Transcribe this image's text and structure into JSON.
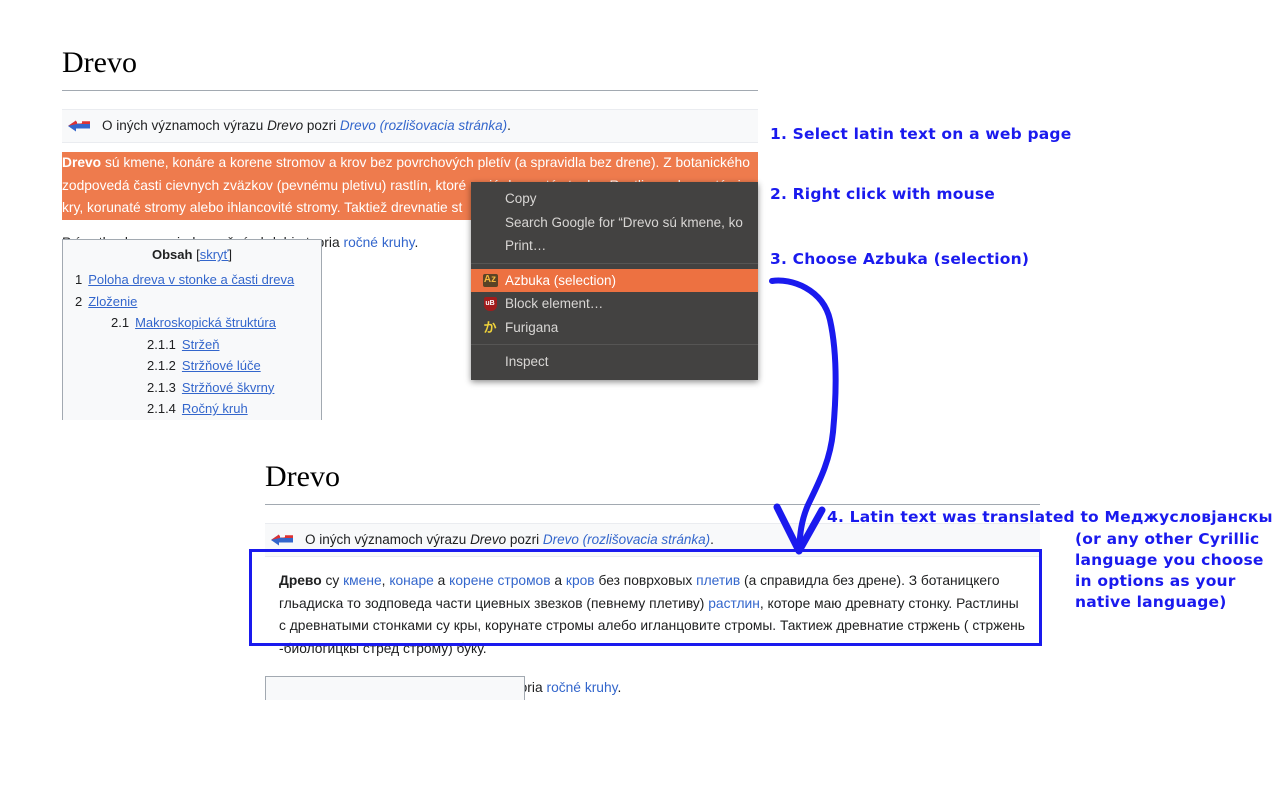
{
  "article_top": {
    "title": "Drevo",
    "hatnote": {
      "prefix": "O iných významoch výrazu ",
      "term": "Drevo",
      "middle": " pozri ",
      "link": "Drevo (rozlišovacia stránka)",
      "suffix": "."
    },
    "selection_paragraph": {
      "lead": "Drevo",
      "rest": " sú kmene, konáre a korene stromov a krov bez povrchových pletív (a spravidla bez drene). Z botanického zodpovedá časti cievnych zväzkov (pevnému pletivu) rastlín, ktoré majú drevnatú stonku. Rastliny s drevnatými s kry, korunaté stromy alebo ihlancovité stromy. Taktiež drevnatie st"
    },
    "second_paragraph": {
      "before": "Prírastky dreva za jedno ročné obdobie tvoria ",
      "link": "ročné kruhy",
      "after": "."
    },
    "toc": {
      "heading": "Obsah",
      "toggle_open": "[",
      "toggle_label": "skryť",
      "toggle_close": "]",
      "rows": [
        {
          "num": "1",
          "label": "Poloha dreva v stonke a časti dreva",
          "level": 1
        },
        {
          "num": "2",
          "label": "Zloženie",
          "level": 1
        },
        {
          "num": "2.1",
          "label": "Makroskopická štruktúra",
          "level": 2
        },
        {
          "num": "2.1.1",
          "label": "Stržeň",
          "level": 3
        },
        {
          "num": "2.1.2",
          "label": "Stržňové lúče",
          "level": 3
        },
        {
          "num": "2.1.3",
          "label": "Stržňové škvrny",
          "level": 3
        },
        {
          "num": "2.1.4",
          "label": "Ročný kruh",
          "level": 3
        }
      ]
    }
  },
  "context_menu": {
    "items": [
      {
        "label": "Copy",
        "icon": null,
        "highlight": false,
        "separator_after": false
      },
      {
        "label": "Search Google for “Drevo sú kmene, ko",
        "icon": null,
        "highlight": false,
        "separator_after": false
      },
      {
        "label": "Print…",
        "icon": null,
        "highlight": false,
        "separator_after": true
      },
      {
        "label": "Azbuka (selection)",
        "icon": "azbuka-icon",
        "highlight": true,
        "separator_after": false
      },
      {
        "label": "Block element…",
        "icon": "ublock-shield-icon",
        "highlight": false,
        "separator_after": false
      },
      {
        "label": "Furigana",
        "icon": "furigana-icon",
        "highlight": false,
        "separator_after": true
      },
      {
        "label": "Inspect",
        "icon": null,
        "highlight": false,
        "separator_after": false
      }
    ],
    "icon_glyphs": {
      "azbuka-icon": "Аz",
      "ublock-shield-icon": "uB",
      "furigana-icon": "か"
    },
    "colors": {
      "background": "#434241",
      "highlight": "#ed7141",
      "text": "#d8d6d4"
    }
  },
  "article_bottom": {
    "title": "Drevo",
    "hatnote": {
      "prefix": "O iných významoch výrazu ",
      "term": "Drevo",
      "middle": " pozri ",
      "link": "Drevo (rozlišovacia stránka)",
      "suffix": "."
    },
    "translated_paragraph": {
      "lead": "Древо",
      "segments": [
        {
          "text": " су ",
          "link": false
        },
        {
          "text": "кмене",
          "link": true
        },
        {
          "text": ", ",
          "link": false
        },
        {
          "text": "конаре",
          "link": true
        },
        {
          "text": " а ",
          "link": false
        },
        {
          "text": "корене стромов",
          "link": true
        },
        {
          "text": " а ",
          "link": false
        },
        {
          "text": "кров",
          "link": true
        },
        {
          "text": " без поврховых ",
          "link": false
        },
        {
          "text": "плетив",
          "link": true
        },
        {
          "text": " (а справидла без дрене). З ботаницкего гльадиска то зодповеда части циевных звезков (певнему плетиву) ",
          "link": false
        },
        {
          "text": "растлин",
          "link": true
        },
        {
          "text": ", которе маю древнату стонку. Растлины с древнатыми стонками су кры, корунате стромы алебо игланцовите стромы. Тактиеж древнатие стржень ( стржень -биологицкы стред строму) буку.",
          "link": false
        }
      ]
    },
    "second_paragraph": {
      "before": "Prírastky dreva za jedno ročné obdobie tvoria ",
      "link": "ročné kruhy",
      "after": "."
    }
  },
  "annotations": {
    "color": "#1a1aee",
    "step1": "1. Select latin text on a web page",
    "step2": "2. Right click with mouse",
    "step3": "3. Choose Azbuka (selection)",
    "step4_line1": "4. Latin text was translated to Меджусловјанскы",
    "step4_rest": "(or any other Cyrillic language you choose in options as your native language)"
  }
}
